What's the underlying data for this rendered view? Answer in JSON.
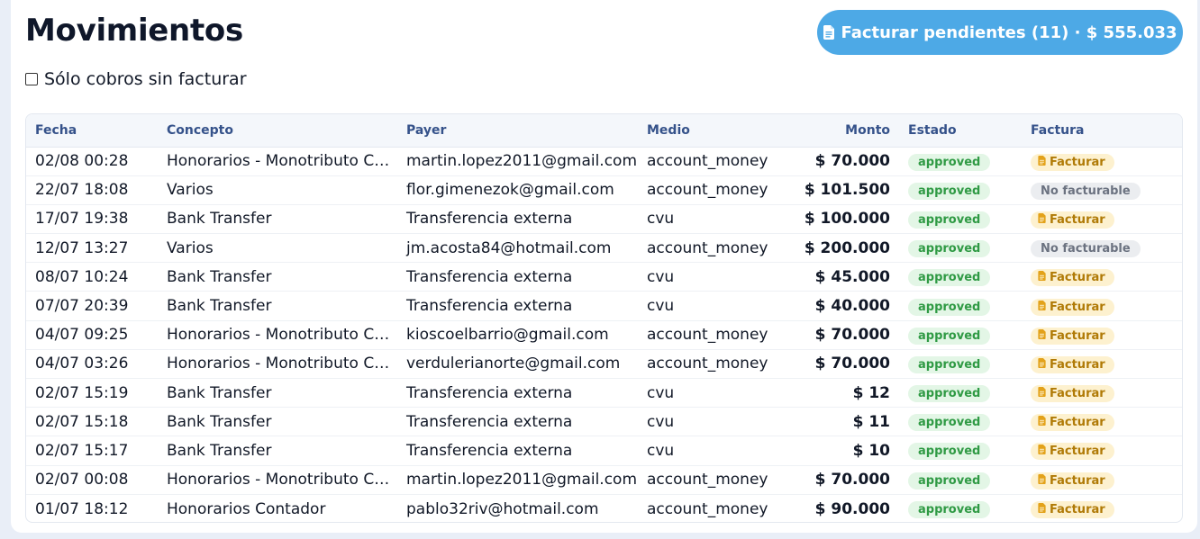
{
  "header": {
    "title": "Movimientos",
    "invoice_button_label": "Facturar pendientes (11) · $ 555.033",
    "invoice_button_icon": "file-invoice-icon"
  },
  "filter": {
    "label": "Sólo cobros sin facturar",
    "checked": false
  },
  "table": {
    "columns": [
      "Fecha",
      "Concepto",
      "Payer",
      "Medio",
      "Monto",
      "Estado",
      "Factura"
    ],
    "rows": [
      {
        "fecha": "02/08 00:28",
        "concepto": "Honorarios - Monotributo Co...",
        "payer": "martin.lopez2011@gmail.com",
        "medio": "account_money",
        "monto": "$ 70.000",
        "estado": "approved",
        "factura": "Facturar",
        "factura_type": "action"
      },
      {
        "fecha": "22/07 18:08",
        "concepto": "Varios",
        "payer": "flor.gimenezok@gmail.com",
        "medio": "account_money",
        "monto": "$ 101.500",
        "estado": "approved",
        "factura": "No facturable",
        "factura_type": "none"
      },
      {
        "fecha": "17/07 19:38",
        "concepto": "Bank Transfer",
        "payer": "Transferencia externa",
        "medio": "cvu",
        "monto": "$ 100.000",
        "estado": "approved",
        "factura": "Facturar",
        "factura_type": "action"
      },
      {
        "fecha": "12/07 13:27",
        "concepto": "Varios",
        "payer": "jm.acosta84@hotmail.com",
        "medio": "account_money",
        "monto": "$ 200.000",
        "estado": "approved",
        "factura": "No facturable",
        "factura_type": "none"
      },
      {
        "fecha": "08/07 10:24",
        "concepto": "Bank Transfer",
        "payer": "Transferencia externa",
        "medio": "cvu",
        "monto": "$ 45.000",
        "estado": "approved",
        "factura": "Facturar",
        "factura_type": "action"
      },
      {
        "fecha": "07/07 20:39",
        "concepto": "Bank Transfer",
        "payer": "Transferencia externa",
        "medio": "cvu",
        "monto": "$ 40.000",
        "estado": "approved",
        "factura": "Facturar",
        "factura_type": "action"
      },
      {
        "fecha": "04/07 09:25",
        "concepto": "Honorarios - Monotributo Co...",
        "payer": "kioscoelbarrio@gmail.com",
        "medio": "account_money",
        "monto": "$ 70.000",
        "estado": "approved",
        "factura": "Facturar",
        "factura_type": "action"
      },
      {
        "fecha": "04/07 03:26",
        "concepto": "Honorarios - Monotributo Co...",
        "payer": "verdulerianorte@gmail.com",
        "medio": "account_money",
        "monto": "$ 70.000",
        "estado": "approved",
        "factura": "Facturar",
        "factura_type": "action"
      },
      {
        "fecha": "02/07 15:19",
        "concepto": "Bank Transfer",
        "payer": "Transferencia externa",
        "medio": "cvu",
        "monto": "$ 12",
        "estado": "approved",
        "factura": "Facturar",
        "factura_type": "action"
      },
      {
        "fecha": "02/07 15:18",
        "concepto": "Bank Transfer",
        "payer": "Transferencia externa",
        "medio": "cvu",
        "monto": "$ 11",
        "estado": "approved",
        "factura": "Facturar",
        "factura_type": "action"
      },
      {
        "fecha": "02/07 15:17",
        "concepto": "Bank Transfer",
        "payer": "Transferencia externa",
        "medio": "cvu",
        "monto": "$ 10",
        "estado": "approved",
        "factura": "Facturar",
        "factura_type": "action"
      },
      {
        "fecha": "02/07 00:08",
        "concepto": "Honorarios - Monotributo Co...",
        "payer": "martin.lopez2011@gmail.com",
        "medio": "account_money",
        "monto": "$ 70.000",
        "estado": "approved",
        "factura": "Facturar",
        "factura_type": "action"
      },
      {
        "fecha": "01/07 18:12",
        "concepto": "Honorarios Contador",
        "payer": "pablo32riv@hotmail.com",
        "medio": "account_money",
        "monto": "$ 90.000",
        "estado": "approved",
        "factura": "Facturar",
        "factura_type": "action"
      }
    ]
  },
  "colors": {
    "accent": "#4da9e6",
    "status_approved_bg": "#e3f6e6",
    "status_approved_text": "#2f9a44",
    "invoice_badge_bg": "#fdf1cf",
    "invoice_badge_text": "#b07a06",
    "not_invoiceable_bg": "#ebedf0",
    "header_text": "#35528a"
  }
}
